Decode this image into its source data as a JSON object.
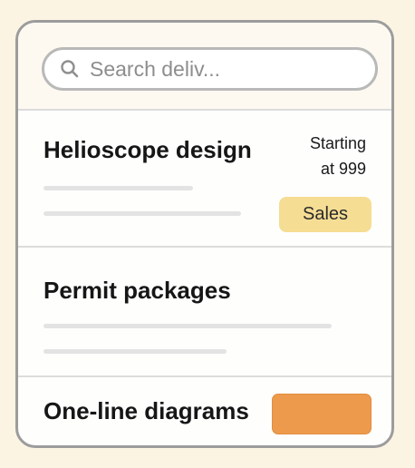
{
  "search": {
    "placeholder": "Search deliv...",
    "icon": "search-icon"
  },
  "items": [
    {
      "title": "Helioscope design",
      "price_line1": "Starting",
      "price_line2": "at 999",
      "badge": "Sales",
      "badge_color": "#f6dd94"
    },
    {
      "title": "Permit packages"
    },
    {
      "title": "One-line diagrams",
      "button_color": "#ee9a4c"
    }
  ],
  "colors": {
    "background": "#fcf4e3",
    "card_border": "#9c9c9c",
    "divider": "#dcdcdc",
    "placeholder_line": "#e3e3e3"
  }
}
